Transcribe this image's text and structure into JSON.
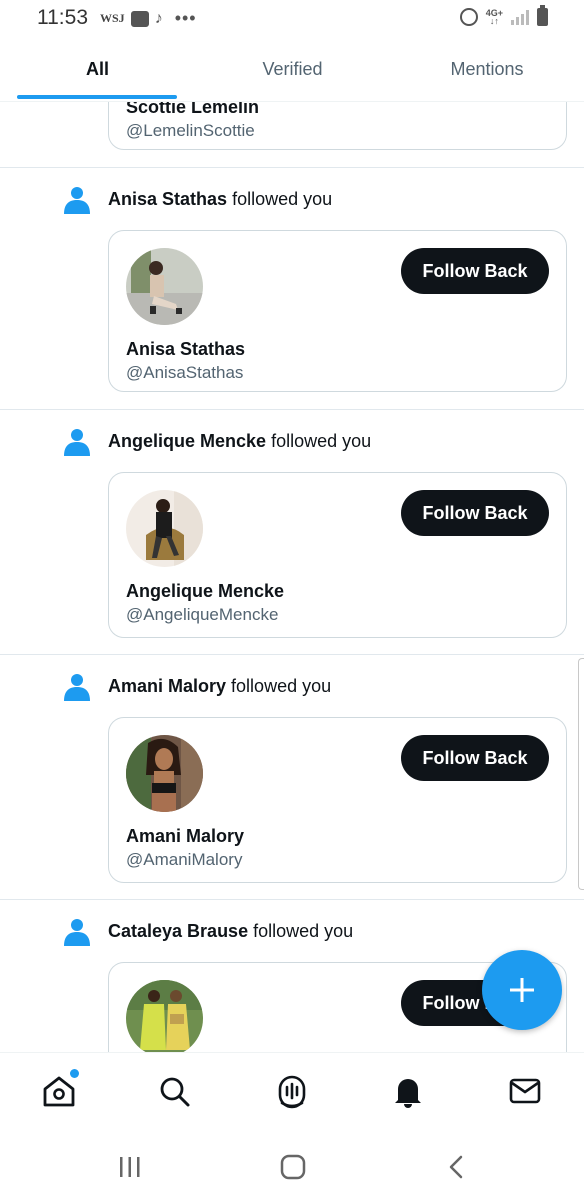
{
  "status_bar": {
    "time": "11:53",
    "wsj_label": "WSJ",
    "network_label": "4G+"
  },
  "tabs": [
    {
      "label": "All",
      "active": true
    },
    {
      "label": "Verified",
      "active": false
    },
    {
      "label": "Mentions",
      "active": false
    }
  ],
  "notifications": [
    {
      "name": "Scottie Lemelin",
      "handle": "@LemelinScottie"
    },
    {
      "name": "Anisa Stathas",
      "action": "followed you",
      "handle": "@AnisaStathas",
      "button": "Follow Back"
    },
    {
      "name": "Angelique Mencke",
      "action": "followed you",
      "handle": "@AngeliqueMencke",
      "button": "Follow Back"
    },
    {
      "name": "Amani Malory",
      "action": "followed you",
      "handle": "@AmaniMalory",
      "button": "Follow Back"
    },
    {
      "name": "Cataleya Brause",
      "action": "followed you",
      "button": "Follow Back"
    }
  ],
  "bottom_nav": [
    "home-icon",
    "search-icon",
    "spaces-icon",
    "notifications-icon",
    "messages-icon"
  ],
  "colors": {
    "accent": "#1d9bf0",
    "text": "#0f1419",
    "muted": "#536471",
    "border": "#cfd9de"
  }
}
